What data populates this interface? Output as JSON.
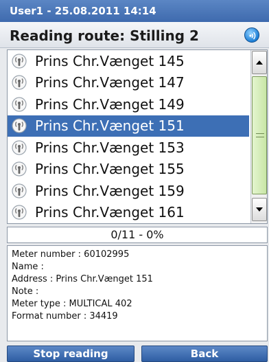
{
  "header": {
    "user_datetime": "User1 - 25.08.2011 14:14",
    "route_title": "Reading route: Stilling 2",
    "signal_icon": "signal-icon"
  },
  "route_list": {
    "items": [
      {
        "label": "Prins Chr.Vænget 145",
        "icon": "radio-meter-icon",
        "selected": false
      },
      {
        "label": "Prins Chr.Vænget 147",
        "icon": "radio-meter-icon",
        "selected": false
      },
      {
        "label": "Prins Chr.Vænget 149",
        "icon": "radio-meter-icon",
        "selected": false
      },
      {
        "label": "Prins Chr.Vænget 151",
        "icon": "radio-meter-icon",
        "selected": true
      },
      {
        "label": "Prins Chr.Vænget 153",
        "icon": "radio-meter-icon",
        "selected": false
      },
      {
        "label": "Prins Chr.Vænget 155",
        "icon": "radio-meter-icon",
        "selected": false
      },
      {
        "label": "Prins Chr.Vænget 159",
        "icon": "radio-meter-icon",
        "selected": false
      },
      {
        "label": "Prins Chr.Vænget 161",
        "icon": "radio-meter-icon",
        "selected": false
      }
    ]
  },
  "progress": {
    "text": "0/11 - 0%"
  },
  "details": {
    "lines": [
      "Meter number : 60102995",
      "Name :",
      "Address : Prins Chr.Vænget 151",
      "Note :",
      "Meter type : MULTICAL 402",
      "Format number : 34419"
    ]
  },
  "buttons": {
    "stop_label": "Stop reading",
    "back_label": "Back"
  },
  "colors": {
    "title_bar": "#3e6aae",
    "selection": "#3d6fb5",
    "scroll_thumb": "#c8e6a6",
    "button": "#2f5ea3"
  }
}
